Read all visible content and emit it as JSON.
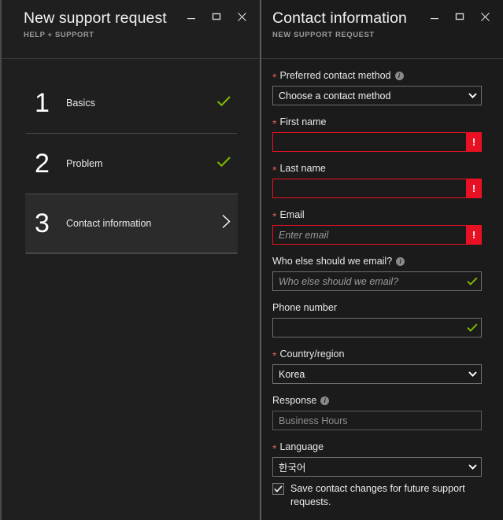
{
  "colors": {
    "blade_bg_left": "#1f1f1f",
    "blade_bg_right": "#1b1b1b",
    "accent_error": "#e81123",
    "accent_valid": "#7fba00",
    "required_star": "#e05c5c",
    "border": "#6e6e6e",
    "text_primary": "#f0f0f0",
    "text_muted": "#9a9a9a"
  },
  "left_blade": {
    "title": "New support request",
    "subtitle": "HELP + SUPPORT",
    "window_controls": [
      {
        "name": "minimize-icon",
        "label": "Minimize"
      },
      {
        "name": "restore-icon",
        "label": "Restore"
      },
      {
        "name": "close-icon",
        "label": "Close"
      }
    ],
    "steps": [
      {
        "number": "1",
        "label": "Basics",
        "status_icon": "checkmark-icon",
        "status": "complete",
        "active": false
      },
      {
        "number": "2",
        "label": "Problem",
        "status_icon": "checkmark-icon",
        "status": "complete",
        "active": false
      },
      {
        "number": "3",
        "label": "Contact information",
        "status_icon": "chevron-right-icon",
        "status": "current",
        "active": true
      }
    ]
  },
  "right_blade": {
    "title": "Contact information",
    "subtitle": "NEW SUPPORT REQUEST",
    "window_controls": [
      {
        "name": "minimize-icon",
        "label": "Minimize"
      },
      {
        "name": "restore-icon",
        "label": "Restore"
      },
      {
        "name": "close-icon",
        "label": "Close"
      }
    ],
    "fields": {
      "preferred_contact_method": {
        "label": "Preferred contact method",
        "required": true,
        "info": true,
        "type": "select",
        "value": "Choose a contact method",
        "state": "normal"
      },
      "first_name": {
        "label": "First name",
        "required": true,
        "info": false,
        "type": "text",
        "value": "",
        "placeholder": "",
        "state": "error"
      },
      "last_name": {
        "label": "Last name",
        "required": true,
        "info": false,
        "type": "text",
        "value": "",
        "placeholder": "",
        "state": "error"
      },
      "email": {
        "label": "Email",
        "required": true,
        "info": false,
        "type": "text",
        "value": "",
        "placeholder": "Enter email",
        "state": "error"
      },
      "additional_email": {
        "label": "Who else should we email?",
        "required": false,
        "info": true,
        "type": "text",
        "value": "",
        "placeholder": "Who else should we email?",
        "state": "valid"
      },
      "phone_number": {
        "label": "Phone number",
        "required": false,
        "info": false,
        "type": "text",
        "value": "",
        "placeholder": "",
        "state": "valid"
      },
      "country_region": {
        "label": "Country/region",
        "required": true,
        "info": false,
        "type": "select",
        "value": "Korea",
        "state": "normal"
      },
      "response": {
        "label": "Response",
        "required": false,
        "info": true,
        "type": "readonly",
        "value": "Business Hours",
        "state": "readonly"
      },
      "language": {
        "label": "Language",
        "required": true,
        "info": false,
        "type": "select",
        "value": "한국어",
        "state": "normal"
      }
    },
    "save_contact_checkbox": {
      "label": "Save contact changes for future support requests.",
      "checked": true
    }
  }
}
